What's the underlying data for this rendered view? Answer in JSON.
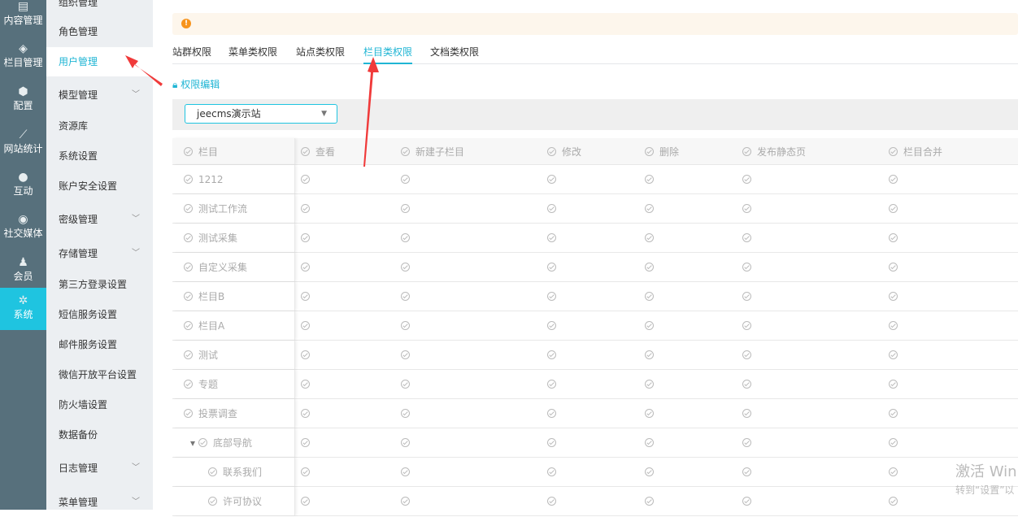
{
  "iconbar": [
    {
      "label": "内容管理",
      "icon": "document-icon",
      "glyph": "▤"
    },
    {
      "label": "栏目管理",
      "icon": "layers-icon",
      "glyph": "◈"
    },
    {
      "label": "配置",
      "icon": "cube-icon",
      "glyph": "⬢"
    },
    {
      "label": "网站统计",
      "icon": "chart-icon",
      "glyph": "⟋"
    },
    {
      "label": "互动",
      "icon": "chat-icon",
      "glyph": "●"
    },
    {
      "label": "社交媒体",
      "icon": "target-icon",
      "glyph": "◉"
    },
    {
      "label": "会员",
      "icon": "member-icon",
      "glyph": "♟"
    },
    {
      "label": "系统",
      "icon": "gear-icon",
      "glyph": "✲",
      "active": true
    }
  ],
  "submenu": [
    {
      "label": "组织管理"
    },
    {
      "label": "角色管理"
    },
    {
      "label": "用户管理",
      "active": true
    },
    {
      "label": "模型管理",
      "expand": true
    },
    {
      "label": "资源库"
    },
    {
      "label": "系统设置"
    },
    {
      "label": "账户安全设置"
    },
    {
      "label": "密级管理",
      "expand": true
    },
    {
      "label": "存储管理",
      "expand": true
    },
    {
      "label": "第三方登录设置"
    },
    {
      "label": "短信服务设置"
    },
    {
      "label": "邮件服务设置"
    },
    {
      "label": "微信开放平台设置"
    },
    {
      "label": "防火墙设置"
    },
    {
      "label": "数据备份"
    },
    {
      "label": "日志管理",
      "expand": true
    },
    {
      "label": "菜单管理",
      "expand": true
    }
  ],
  "alert_icon": "!",
  "tabs": [
    {
      "label": "站群权限"
    },
    {
      "label": "菜单类权限"
    },
    {
      "label": "站点类权限"
    },
    {
      "label": "栏目类权限",
      "active": true
    },
    {
      "label": "文档类权限"
    }
  ],
  "edit_label": "权限编辑",
  "site_select": {
    "value": "jeecms演示站"
  },
  "table": {
    "columns": [
      "栏目",
      "查看",
      "新建子栏目",
      "修改",
      "删除",
      "发布静态页",
      "栏目合并"
    ],
    "rows": [
      {
        "name": "1212",
        "level": 0
      },
      {
        "name": "测试工作流",
        "level": 0
      },
      {
        "name": "测试采集",
        "level": 0
      },
      {
        "name": "自定义采集",
        "level": 0
      },
      {
        "name": "栏目B",
        "level": 0
      },
      {
        "name": "栏目A",
        "level": 0
      },
      {
        "name": "测试",
        "level": 0
      },
      {
        "name": "专题",
        "level": 0
      },
      {
        "name": "投票调查",
        "level": 0
      },
      {
        "name": "底部导航",
        "level": 1,
        "expanded": true
      },
      {
        "name": "联系我们",
        "level": 2
      },
      {
        "name": "许可协议",
        "level": 2
      }
    ]
  },
  "watermark": {
    "line1": "激活 Win",
    "line2": "转到“设置”以"
  },
  "colors": {
    "accent": "#1fc4e0",
    "sidebar": "#57707c",
    "annotation": "#f03a3a"
  }
}
